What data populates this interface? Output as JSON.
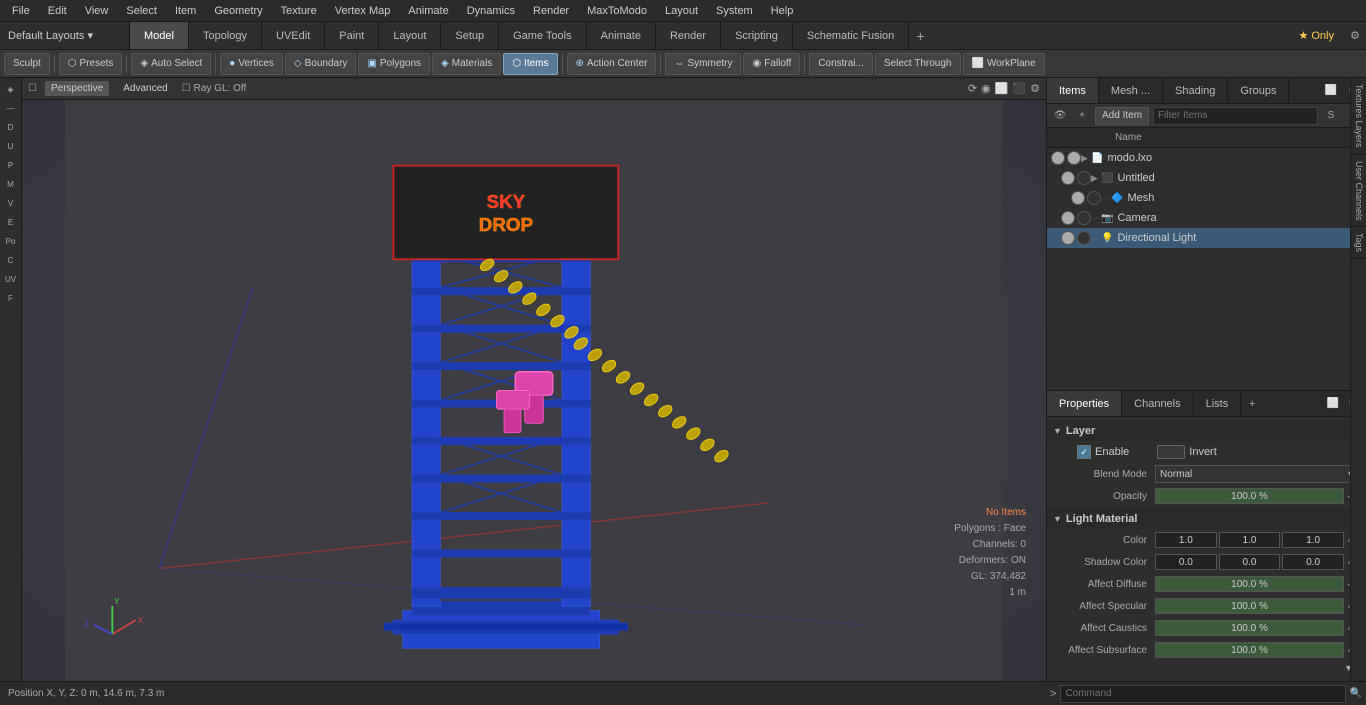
{
  "menu": {
    "items": [
      "File",
      "Edit",
      "View",
      "Select",
      "Item",
      "Geometry",
      "Texture",
      "Vertex Map",
      "Animate",
      "Dynamics",
      "Render",
      "MaxToModo",
      "Layout",
      "System",
      "Help"
    ]
  },
  "layout_bar": {
    "dropdown_label": "Default Layouts ▾",
    "tabs": [
      "Model",
      "Topology",
      "UVEdit",
      "Paint",
      "Layout",
      "Setup",
      "Game Tools",
      "Animate",
      "Render",
      "Scripting",
      "Schematic Fusion"
    ],
    "active_tab": "Model",
    "plus_label": "+",
    "star_label": "★ Only",
    "gear_label": "⚙"
  },
  "toolbar": {
    "sculpt": "Sculpt",
    "presets": "Presets",
    "auto_select": "Auto Select",
    "vertices": "Vertices",
    "boundary": "Boundary",
    "polygons": "Polygons",
    "materials": "Materials",
    "items": "Items",
    "action_center": "Action Center",
    "symmetry": "Symmetry",
    "falloff": "Falloff",
    "constraints": "Constrai...",
    "select_through": "Select Through",
    "workplane": "WorkPlane"
  },
  "viewport": {
    "tabs": [
      "Perspective",
      "Advanced"
    ],
    "ray_gl": "Ray GL: Off",
    "icons": [
      "⟳",
      "◉",
      "⬜",
      "⬛",
      "⚙"
    ]
  },
  "viewport_info": {
    "no_items": "No Items",
    "polygons": "Polygons : Face",
    "channels": "Channels: 0",
    "deformers": "Deformers: ON",
    "gl": "GL: 374,482",
    "scale": "1 m"
  },
  "status_bar": {
    "position": "Position X, Y, Z:  0 m, 14.6 m, 7.3 m"
  },
  "right_panel": {
    "top_tabs": [
      "Items",
      "Mesh ...",
      "Shading",
      "Groups"
    ],
    "active_top_tab": "Items",
    "items_toolbar": {
      "add_item": "Add Item",
      "filter_placeholder": "Filter Items"
    },
    "items_list_header": {
      "name_col": "Name"
    },
    "items": [
      {
        "id": "modo_lxo",
        "name": "modo.lxo",
        "indent": 0,
        "expanded": true,
        "icon": "📁",
        "vis": true
      },
      {
        "id": "untitled",
        "name": "Untitled",
        "indent": 1,
        "expanded": true,
        "icon": "📦",
        "vis": true
      },
      {
        "id": "mesh",
        "name": "Mesh",
        "indent": 2,
        "expanded": false,
        "icon": "🔷",
        "vis": true
      },
      {
        "id": "camera",
        "name": "Camera",
        "indent": 1,
        "expanded": false,
        "icon": "📷",
        "vis": true
      },
      {
        "id": "directional_light",
        "name": "Directional Light",
        "indent": 1,
        "expanded": false,
        "icon": "💡",
        "vis": true
      }
    ]
  },
  "properties": {
    "tabs": [
      "Properties",
      "Channels",
      "Lists"
    ],
    "active_tab": "Properties",
    "plus_label": "+",
    "sections": {
      "layer": {
        "label": "Layer",
        "enable_label": "Enable",
        "enable_checked": true,
        "invert_label": "Invert",
        "invert_checked": false,
        "blend_mode_label": "Blend Mode",
        "blend_mode_value": "Normal",
        "opacity_label": "Opacity",
        "opacity_value": "100.0 %",
        "opacity_pct": 100
      },
      "light_material": {
        "label": "Light Material",
        "color_label": "Color",
        "color_r": "1.0",
        "color_g": "1.0",
        "color_b": "1.0",
        "shadow_color_label": "Shadow Color",
        "shadow_r": "0.0",
        "shadow_g": "0.0",
        "shadow_b": "0.0",
        "affect_diffuse_label": "Affect Diffuse",
        "affect_diffuse_value": "100.0 %",
        "affect_specular_label": "Affect Specular",
        "affect_specular_value": "100.0 %",
        "affect_caustics_label": "Affect Caustics",
        "affect_caustics_value": "100.0 %",
        "affect_subsurface_label": "Affect Subsurface",
        "affect_subsurface_value": "100.0 %"
      }
    }
  },
  "right_vtabs": [
    "Textures Layers",
    "User Channels",
    "Tags"
  ],
  "command_bar": {
    "arrow_label": ">",
    "placeholder": "Command"
  }
}
